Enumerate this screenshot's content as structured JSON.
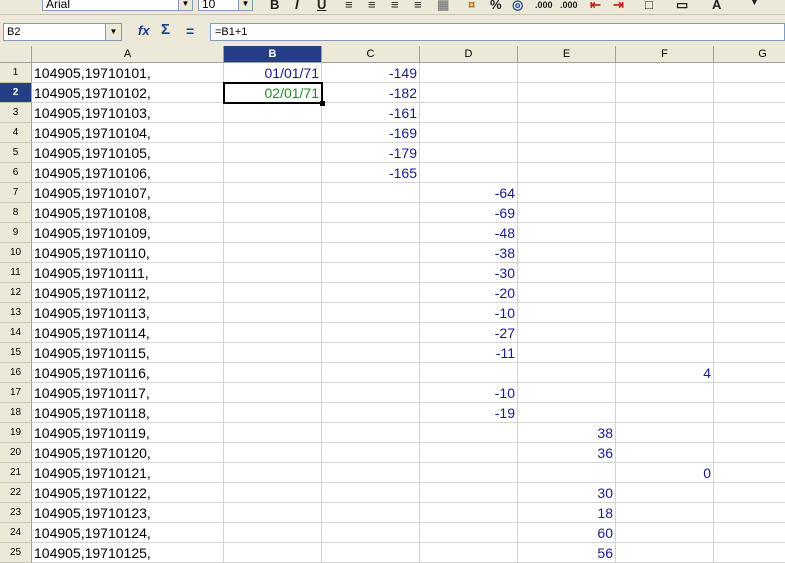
{
  "toolbar": {
    "font_name": "Arial",
    "font_size": "10",
    "icons": [
      "bold-icon",
      "italic-icon",
      "underline-icon",
      "align-left-icon",
      "align-center-icon",
      "align-right-icon",
      "justify-icon",
      "merge-icon",
      "currency-icon",
      "percent-icon",
      "number-format-icon",
      "add-decimal-icon",
      "delete-decimal-icon",
      "decrease-indent-icon",
      "increase-indent-icon",
      "borders-icon",
      "background-color-icon",
      "font-color-icon"
    ],
    "labels": {
      "bold": "B",
      "italic": "I",
      "underline": "U",
      "percent": "%",
      "add_decimal": ".000",
      "del_decimal": ".000"
    }
  },
  "formula_bar": {
    "name_box": "B2",
    "formula": "=B1+1",
    "function_wizard": "fx",
    "sum": "Σ",
    "equals": "="
  },
  "columns": [
    "A",
    "B",
    "C",
    "D",
    "E",
    "F",
    "G"
  ],
  "selected_column": "B",
  "selected_row": 2,
  "rows": [
    {
      "n": "1",
      "a": "104905,19710101,",
      "b": "01/01/71",
      "c": "-149",
      "d": "",
      "e": "",
      "f": ""
    },
    {
      "n": "2",
      "a": "104905,19710102,",
      "b": "02/01/71",
      "c": "-182",
      "d": "",
      "e": "",
      "f": ""
    },
    {
      "n": "3",
      "a": "104905,19710103,",
      "b": "",
      "c": "-161",
      "d": "",
      "e": "",
      "f": ""
    },
    {
      "n": "4",
      "a": "104905,19710104,",
      "b": "",
      "c": "-169",
      "d": "",
      "e": "",
      "f": ""
    },
    {
      "n": "5",
      "a": "104905,19710105,",
      "b": "",
      "c": "-179",
      "d": "",
      "e": "",
      "f": ""
    },
    {
      "n": "6",
      "a": "104905,19710106,",
      "b": "",
      "c": "-165",
      "d": "",
      "e": "",
      "f": ""
    },
    {
      "n": "7",
      "a": "104905,19710107,",
      "b": "",
      "c": "",
      "d": "-64",
      "e": "",
      "f": ""
    },
    {
      "n": "8",
      "a": "104905,19710108,",
      "b": "",
      "c": "",
      "d": "-69",
      "e": "",
      "f": ""
    },
    {
      "n": "9",
      "a": "104905,19710109,",
      "b": "",
      "c": "",
      "d": "-48",
      "e": "",
      "f": ""
    },
    {
      "n": "10",
      "a": "104905,19710110,",
      "b": "",
      "c": "",
      "d": "-38",
      "e": "",
      "f": ""
    },
    {
      "n": "11",
      "a": "104905,19710111,",
      "b": "",
      "c": "",
      "d": "-30",
      "e": "",
      "f": ""
    },
    {
      "n": "12",
      "a": "104905,19710112,",
      "b": "",
      "c": "",
      "d": "-20",
      "e": "",
      "f": ""
    },
    {
      "n": "13",
      "a": "104905,19710113,",
      "b": "",
      "c": "",
      "d": "-10",
      "e": "",
      "f": ""
    },
    {
      "n": "14",
      "a": "104905,19710114,",
      "b": "",
      "c": "",
      "d": "-27",
      "e": "",
      "f": ""
    },
    {
      "n": "15",
      "a": "104905,19710115,",
      "b": "",
      "c": "",
      "d": "-11",
      "e": "",
      "f": ""
    },
    {
      "n": "16",
      "a": "104905,19710116,",
      "b": "",
      "c": "",
      "d": "",
      "e": "",
      "f": "4"
    },
    {
      "n": "17",
      "a": "104905,19710117,",
      "b": "",
      "c": "",
      "d": "-10",
      "e": "",
      "f": ""
    },
    {
      "n": "18",
      "a": "104905,19710118,",
      "b": "",
      "c": "",
      "d": "-19",
      "e": "",
      "f": ""
    },
    {
      "n": "19",
      "a": "104905,19710119,",
      "b": "",
      "c": "",
      "d": "",
      "e": "38",
      "f": ""
    },
    {
      "n": "20",
      "a": "104905,19710120,",
      "b": "",
      "c": "",
      "d": "",
      "e": "36",
      "f": ""
    },
    {
      "n": "21",
      "a": "104905,19710121,",
      "b": "",
      "c": "",
      "d": "",
      "e": "",
      "f": "0"
    },
    {
      "n": "22",
      "a": "104905,19710122,",
      "b": "",
      "c": "",
      "d": "",
      "e": "30",
      "f": ""
    },
    {
      "n": "23",
      "a": "104905,19710123,",
      "b": "",
      "c": "",
      "d": "",
      "e": "18",
      "f": ""
    },
    {
      "n": "24",
      "a": "104905,19710124,",
      "b": "",
      "c": "",
      "d": "",
      "e": "60",
      "f": ""
    },
    {
      "n": "25",
      "a": "104905,19710125,",
      "b": "",
      "c": "",
      "d": "",
      "e": "56",
      "f": ""
    }
  ],
  "colors": {
    "number_text": "#1a1a8c",
    "date_active_text": "#2a8a2a",
    "header_selected": "#263e86",
    "chrome": "#ece9d8"
  }
}
